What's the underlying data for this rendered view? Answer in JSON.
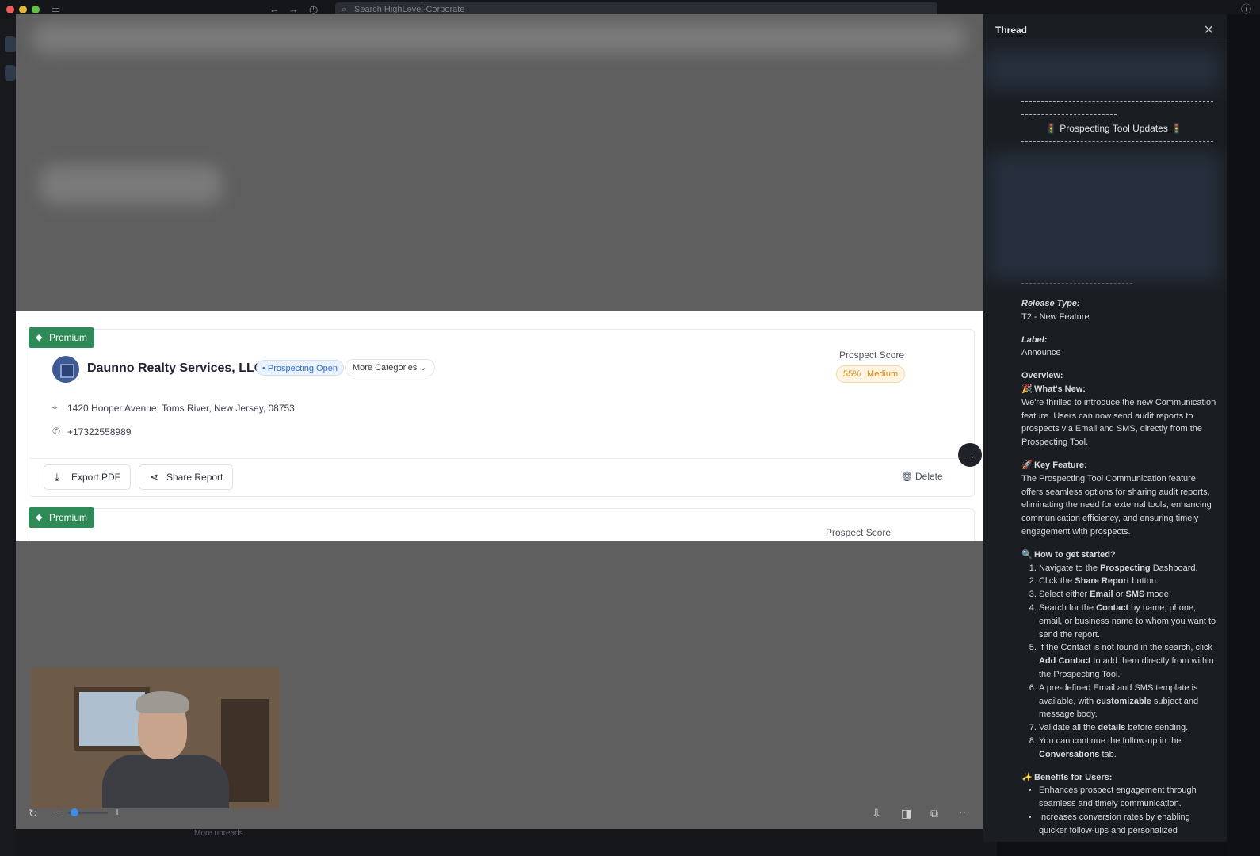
{
  "window": {
    "search_placeholder": "Search HighLevel-Corporate",
    "bottom_hint": "More unreads"
  },
  "card": {
    "premium_label": "Premium",
    "company": "Daunno Realty Services, LLC",
    "status_badge": "• Prospecting Open",
    "more_categories": "More Categories ⌄",
    "address": "1420 Hooper Avenue, Toms River, New Jersey, 08753",
    "phone": "+17322558989",
    "prospect_score_label": "Prospect Score",
    "score_percent": "55%",
    "score_level": "Medium",
    "export_pdf": "Export PDF",
    "share_report": "Share Report",
    "delete": "Delete"
  },
  "card2": {
    "premium_label": "Premium",
    "prospect_score_label": "Prospect Score"
  },
  "thread": {
    "title": "Thread",
    "updates_title": "Prospecting Tool Updates",
    "release_type_label": "Release Type:",
    "release_type_value": "T2 - New Feature",
    "label_label": "Label:",
    "label_value": "Announce",
    "overview_label": "Overview:",
    "whats_new_title": "What's New:",
    "whats_new_text": "We're thrilled to introduce the new Communication feature. Users can now send audit reports to prospects via Email and SMS, directly from the Prospecting Tool.",
    "key_feature_title": "Key Feature:",
    "key_feature_text": "The Prospecting Tool Communication feature offers seamless options for sharing audit reports, eliminating the need for external tools, enhancing communication efficiency, and ensuring timely engagement with prospects.",
    "get_started_title": "How to get started?",
    "steps": [
      {
        "pre": "Navigate to the ",
        "bold": "Prospecting",
        "post": " Dashboard."
      },
      {
        "pre": "Click the ",
        "bold": "Share Report",
        "post": " button."
      },
      {
        "pre": "Select either ",
        "bold": "Email",
        "mid": " or ",
        "bold2": "SMS",
        "post": " mode."
      },
      {
        "pre": "Search for the ",
        "bold": "Contact",
        "post": " by name, phone, email, or business name to whom you want to send the report."
      },
      {
        "pre": "If the Contact is not found in the search, click ",
        "bold": "Add Contact",
        "post": " to add them directly from within the Prospecting Tool."
      },
      {
        "pre": "A pre-defined Email and SMS template is available, with ",
        "bold": "customizable",
        "post": " subject and message body."
      },
      {
        "pre": "Validate all the ",
        "bold": "details",
        "post": " before sending."
      },
      {
        "pre": "You can continue the follow-up in the ",
        "bold": "Conversations",
        "post": " tab."
      }
    ],
    "benefits_title": "Benefits for Users:",
    "benefits": [
      "Enhances prospect engagement through seamless and timely communication.",
      "Increases conversion rates by enabling quicker follow-ups and personalized"
    ]
  },
  "colors": {
    "premium_green": "#2e8b57",
    "badge_blue": "#2f6fd6",
    "score_orange": "#d88a12",
    "panel_bg": "#1a1d21"
  }
}
